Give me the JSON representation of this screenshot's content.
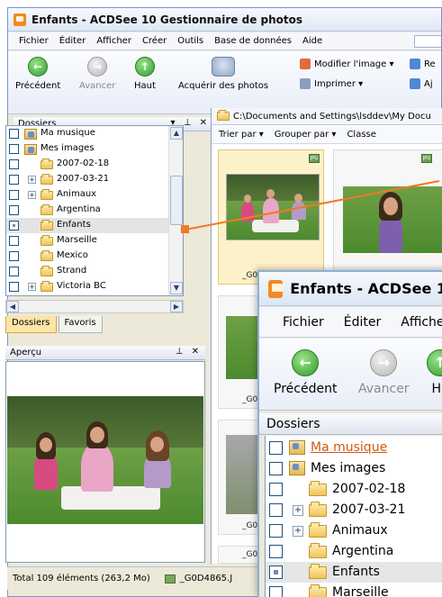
{
  "window": {
    "title": "Enfants - ACDSee 10 Gestionnaire de photos"
  },
  "menu": {
    "items": [
      "Fichier",
      "Éditer",
      "Afficher",
      "Créer",
      "Outils",
      "Base de données",
      "Aide"
    ]
  },
  "toolbar": {
    "back_label": "Précédent",
    "forward_label": "Avancer",
    "up_label": "Haut",
    "acquire_label": "Acquérir des photos",
    "modify_label": "Modifier l'image ▾",
    "print_label": "Imprimer ▾",
    "re_label": "Re",
    "aj_label": "Aj"
  },
  "folders_panel": {
    "title": "Dossiers",
    "controls": "▾ ⊥ ✕",
    "items": [
      "Ma musique",
      "Mes images",
      "2007-02-18",
      "2007-03-21",
      "Animaux",
      "Argentina",
      "Enfants",
      "Marseille",
      "Mexico",
      "Strand",
      "Victoria BC"
    ],
    "tabs": [
      "Dossiers",
      "Favoris"
    ]
  },
  "preview_panel": {
    "title": "Aperçu",
    "controls": "⊥ ✕"
  },
  "status": {
    "total": "Total 109 éléments (263,2 Mo)",
    "file": "_G0D4865.J"
  },
  "main": {
    "path": "C:\\Documents and Settings\\lsddev\\My Docu",
    "sort_label": "Trier par ▾",
    "group_label": "Grouper par ▾",
    "classify_label": "Classe",
    "jpg_badge": "JPG",
    "thumb_label_1": "_G0D",
    "thumb_label_2": "_G0D",
    "thumb_label_3": "_G0D",
    "thumb_label_4": "_G0D"
  },
  "zoom": {
    "title": "Enfants - ACDSee 1",
    "menu": [
      "Fichier",
      "Éditer",
      "Affiche"
    ],
    "back_label": "Précédent",
    "forward_label": "Avancer",
    "up_label": "Ha",
    "folders_title": "Dossiers",
    "items": [
      "Ma musique",
      "Mes images",
      "2007-02-18",
      "2007-03-21",
      "Animaux",
      "Argentina",
      "Enfants",
      "Marseille"
    ]
  },
  "colors": {
    "accent": "#f07a22",
    "tab_active": "#fde5a8",
    "title_gradient_top": "#f7f9fd"
  }
}
